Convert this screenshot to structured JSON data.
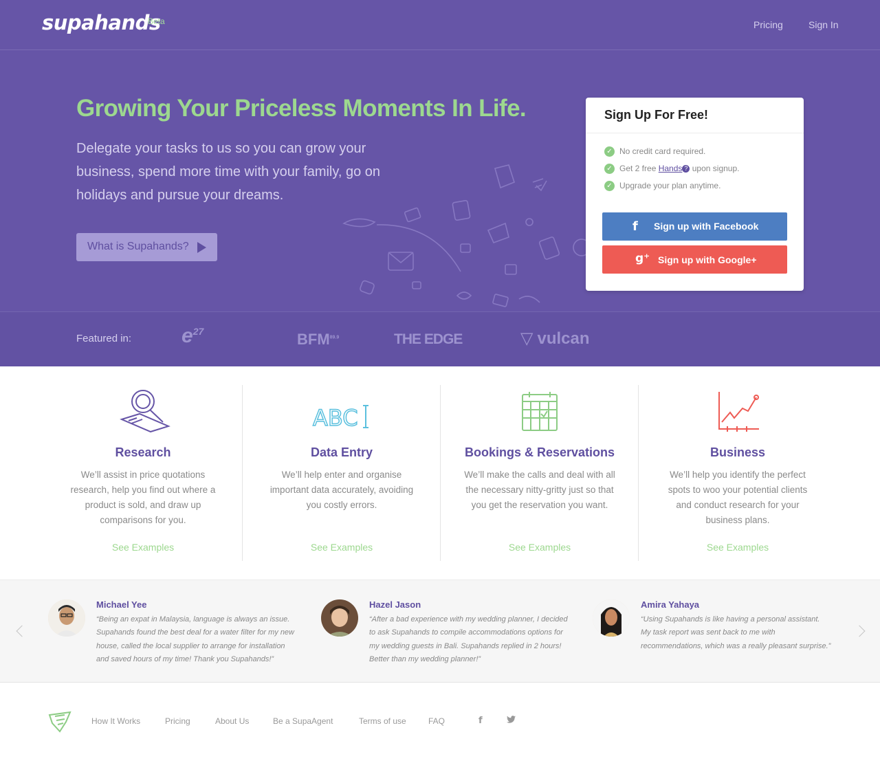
{
  "header": {
    "logo": "supahands",
    "beta": "Beta",
    "nav": {
      "pricing": "Pricing",
      "sign_in": "Sign In"
    }
  },
  "hero": {
    "headline": "Growing Your Priceless Moments In Life.",
    "subline": "Delegate your tasks to us so you can grow your business, spend more time with your family, go on holidays and pursue your dreams.",
    "cta_label": "What is Supahands?"
  },
  "signup": {
    "title": "Sign Up For Free!",
    "benefits": {
      "b1": "No credit card required.",
      "b2_prefix": "Get 2 free",
      "b2_link": "Hands",
      "b2_suffix": "upon signup.",
      "b3": "Upgrade your plan anytime."
    },
    "facebook_label": "Sign up with Facebook",
    "google_label": "Sign up with Google+"
  },
  "featured": {
    "label": "Featured in:",
    "logos": [
      "e27",
      "BFM 89.9",
      "THE EDGE",
      "vulcan post"
    ]
  },
  "services": [
    {
      "title": "Research",
      "desc": "We’ll assist in price quotations research, help you find out where a product is sold, and draw up comparisons for you.",
      "link": "See Examples",
      "icon": "magnifier-icon"
    },
    {
      "title": "Data Entry",
      "desc": "We’ll help enter and organise important data accurately, avoiding you costly errors.",
      "link": "See Examples",
      "icon": "abc-cursor-icon"
    },
    {
      "title": "Bookings & Reservations",
      "desc": "We’ll make the calls and deal with all the necessary nitty-gritty just so that you get the reservation you want.",
      "link": "See Examples",
      "icon": "calendar-icon"
    },
    {
      "title": "Business",
      "desc": "We’ll help you identify the perfect spots to woo your potential clients and conduct research for your business plans.",
      "link": "See Examples",
      "icon": "growth-chart-icon"
    }
  ],
  "testimonials": [
    {
      "name": "Michael Yee",
      "quote": "“Being an expat in Malaysia, language is always an issue. Supahands found the best deal for a water filter for my new house, called the local supplier to arrange for installation and saved hours of my time! Thank you Supahands!”"
    },
    {
      "name": "Hazel Jason",
      "quote": "“After a bad experience with my wedding planner, I decided to ask Supahands to compile accommodations options for my wedding guests in Bali. Supahands replied in 2 hours! Better than my wedding planner!”"
    },
    {
      "name": "Amira Yahaya",
      "quote": "“Using Supahands is like having a personal assistant. My task report was sent back to me with recommendations, which was a really pleasant surprise.”"
    }
  ],
  "footer": {
    "links": [
      "How It Works",
      "Pricing",
      "About Us",
      "Be a SupaAgent",
      "Terms of use",
      "FAQ"
    ],
    "social": {
      "facebook": "f",
      "twitter": "🐦"
    }
  },
  "colors": {
    "brand_purple": "#6655a7",
    "accent_green": "#9dd88f",
    "facebook_blue": "#4d7ec2",
    "google_red": "#ee5b54"
  }
}
